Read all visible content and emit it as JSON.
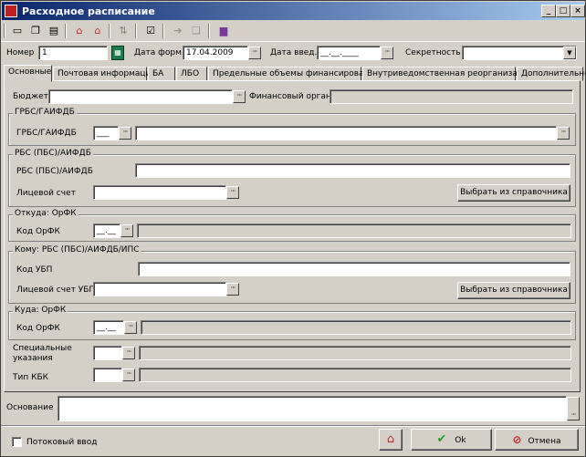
{
  "window": {
    "title": "Расходное расписание",
    "minimize": "_",
    "maximize": "□",
    "close": "×"
  },
  "toolbar": {
    "icons": [
      "save-icon",
      "copy-icon",
      "print-icon",
      "house-up-icon",
      "house-down-icon",
      "refresh-icon",
      "checklist-icon",
      "forward-icon",
      "document-icon",
      "book-icon"
    ]
  },
  "header": {
    "nomer_label": "Номер",
    "nomer_value": "1",
    "data_form_label": "Дата форм.",
    "data_form_value": "17.04.2009",
    "data_vved_label": "Дата введ.",
    "data_vved_value": "__.__.____",
    "sekretnost_label": "Секретность",
    "sekretnost_value": ""
  },
  "tabs": [
    "Основные",
    "Почтовая информация",
    "БА",
    "ЛБО",
    "Предельные объемы финансирования",
    "Внутриведомственная реорганизация",
    "Дополнительно"
  ],
  "main": {
    "budget_label": "Бюджет",
    "budget_value": "",
    "fin_organ_label": "Финансовый орган",
    "fin_organ_value": "",
    "grbs_group": "ГРБС/ГАИФДБ",
    "grbs_label": "ГРБС/ГАИФДБ",
    "grbs_code": "___",
    "grbs_value": "",
    "rbs_group": "РБС (ПБС)/АИФДБ",
    "rbs_label": "РБС (ПБС)/АИФДБ",
    "rbs_value": "",
    "licevoy_label": "Лицевой счет",
    "licevoy_value": "",
    "select_btn1": "Выбрать из справочника",
    "otkuda_group": "Откуда: ОрФК",
    "otkuda_label": "Код ОрФК",
    "otkuda_code": "__.__",
    "otkuda_value": "",
    "komu_group": "Кому: РБС (ПБС)/АИФДБ/ИПС",
    "ubp_label": "Код УБП",
    "ubp_value": "",
    "licevoy_ubp_label": "Лицевой счет УБП",
    "licevoy_ubp_value": "",
    "select_btn2": "Выбрать из справочника",
    "kuda_group": "Куда: ОрФК",
    "kuda_label": "Код ОрФК",
    "kuda_code": "__.__",
    "kuda_value": "",
    "spec_label": "Специальные указания",
    "spec_code": "",
    "spec_value": "",
    "tip_kbk_label": "Тип КБК",
    "tip_kbk_code": "",
    "tip_kbk_value": ""
  },
  "footer": {
    "osnovanie_label": "Основание",
    "osnovanie_value": "",
    "potok_label": "Потоковый ввод",
    "ok_label": "Ok",
    "cancel_label": "Отмена"
  },
  "colors": {
    "title_start": "#0a246a",
    "title_end": "#a6caf0",
    "ok_check": "#2a9a2a",
    "cancel_icon": "#cc2222"
  }
}
